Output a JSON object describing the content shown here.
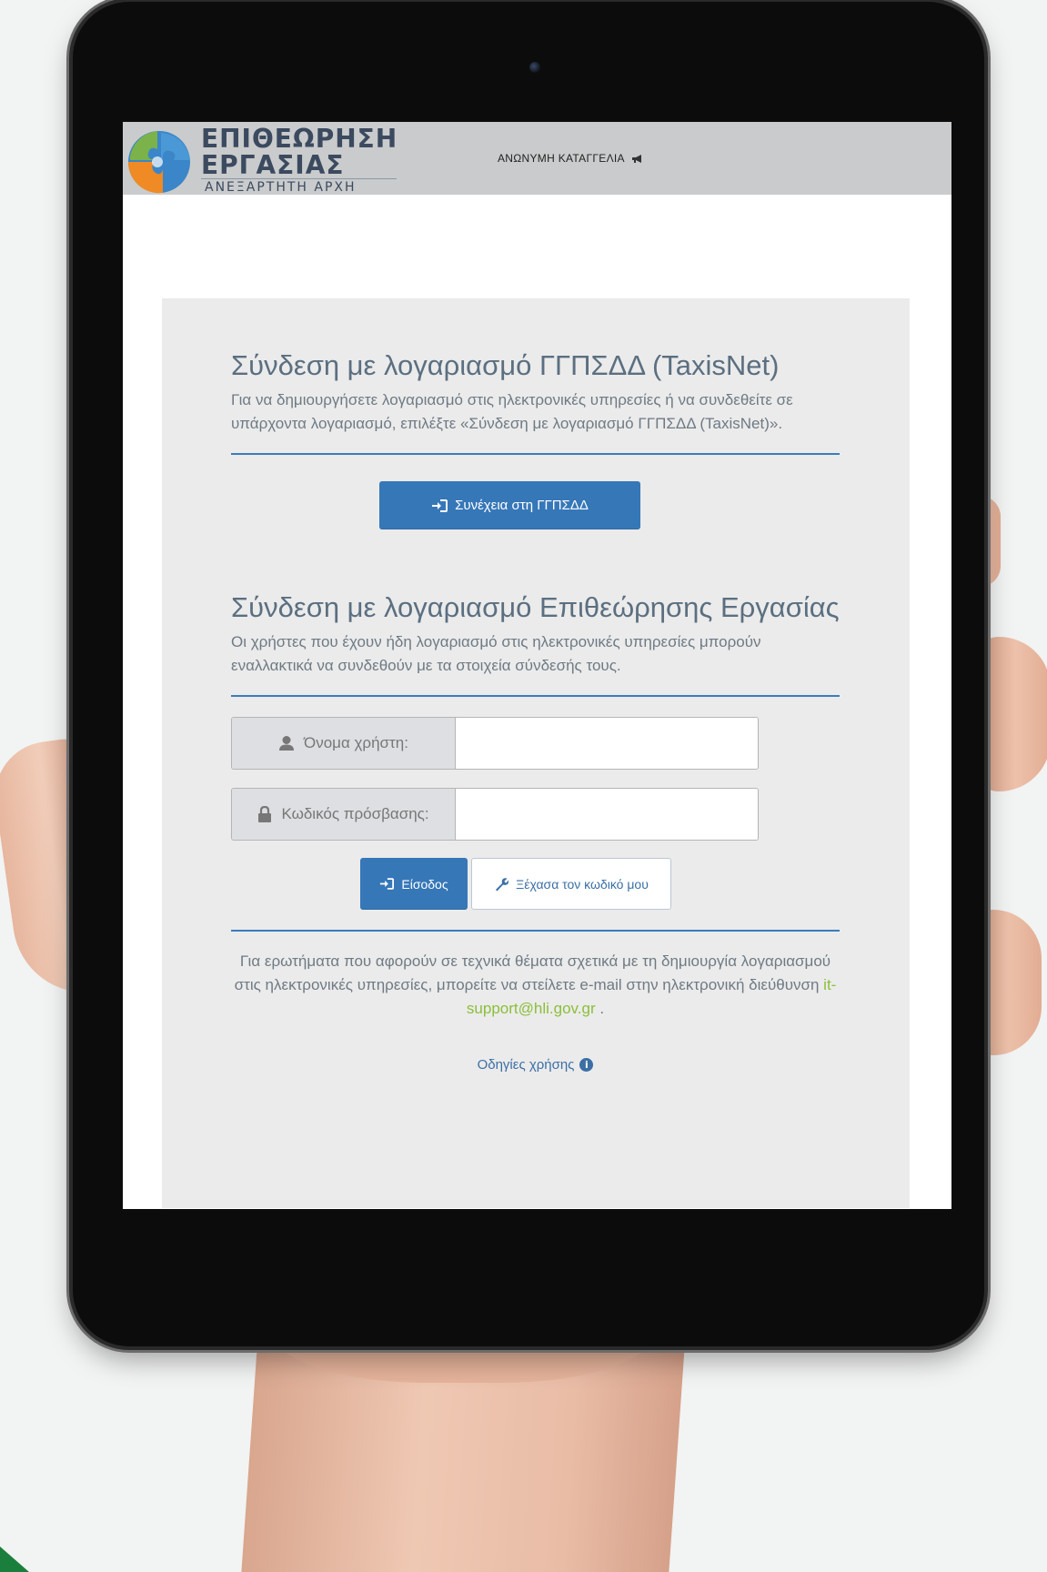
{
  "header": {
    "logo_title_line1": "ΕΠΙΘΕΩΡΗΣΗ",
    "logo_title_line2": "ΕΡΓΑΣΙΑΣ",
    "logo_subtitle": "ΑΝΕΞΑΡΤΗΤΗ ΑΡΧΗ",
    "anonymous_report_label": "ΑΝΩΝΥΜΗ ΚΑΤΑΓΓΕΛΙΑ"
  },
  "taxisnet": {
    "title": "Σύνδεση με λογαριασμό ΓΓΠΣΔΔ (TaxisNet)",
    "description": "Για να δημιουργήσετε λογαριασμό στις ηλεκτρονικές υπηρεσίες ή να συνδεθείτε σε υπάρχοντα λογαριασμό, επιλέξτε «Σύνδεση με λογαριασμό ΓΓΠΣΔΔ (TaxisNet)».",
    "button_label": "Συνέχεια στη ΓΓΠΣΔΔ"
  },
  "local_login": {
    "title": "Σύνδεση με λογαριασμό Επιθεώρησης Εργασίας",
    "description": "Οι χρήστες που έχουν ήδη λογαριασμό στις ηλεκτρονικές υπηρεσίες μπορούν εναλλακτικά να συνδεθούν με τα στοιχεία σύνδεσής τους.",
    "username_label": "Όνομα χρήστη:",
    "username_value": "",
    "password_label": "Κωδικός πρόσβασης:",
    "password_value": "",
    "login_button_label": "Είσοδος",
    "forgot_button_label": "Ξέχασα τον κωδικό μου"
  },
  "help": {
    "text_before": "Για ερωτήματα που αφορούν σε τεχνικά θέματα σχετικά με τη δημιουργία λογαριασμού στις ηλεκτρονικές υπηρεσίες, μπορείτε να στείλετε e-mail στην ηλεκτρονική διεύθυνση ",
    "email": "it-support@hli.gov.gr",
    "text_after": " .",
    "guide_label": "Οδηγίες χρήσης"
  },
  "colors": {
    "primary": "#3677b8",
    "heading": "#5b6f80",
    "link_green": "#8bbf3a",
    "header_bg": "#cacbcc",
    "panel_bg": "#ebebeb"
  },
  "icons": {
    "anonymous_report": "megaphone-icon",
    "taxisnet_button": "sign-in-icon",
    "username": "user-icon",
    "password": "lock-icon",
    "login_button": "sign-in-icon",
    "forgot_button": "wrench-icon",
    "guide": "info-circle-icon"
  }
}
